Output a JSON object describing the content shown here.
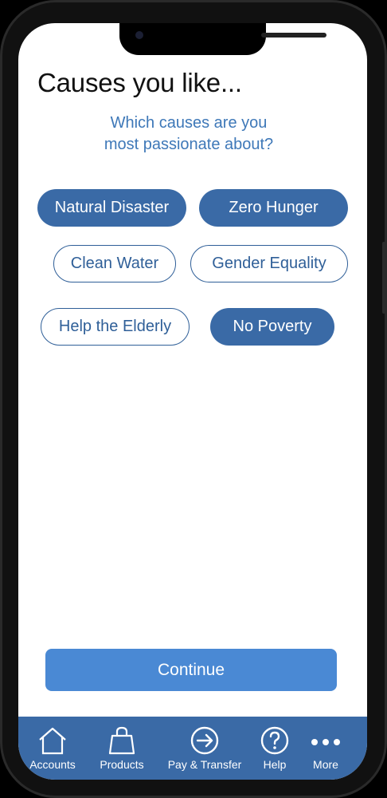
{
  "header": {
    "title": "Causes you like...",
    "subtitle_line1": "Which causes are you",
    "subtitle_line2": "most passionate about?"
  },
  "causes": [
    {
      "label": "Natural Disaster",
      "selected": true
    },
    {
      "label": "Zero Hunger",
      "selected": true
    },
    {
      "label": "Clean Water",
      "selected": false
    },
    {
      "label": "Gender Equality",
      "selected": false
    },
    {
      "label": "Help the Elderly",
      "selected": false
    },
    {
      "label": "No Poverty",
      "selected": true
    }
  ],
  "actions": {
    "continue_label": "Continue"
  },
  "tabbar": {
    "items": [
      {
        "label": "Accounts",
        "icon": "home-icon"
      },
      {
        "label": "Products",
        "icon": "bag-icon"
      },
      {
        "label": "Pay & Transfer",
        "icon": "arrow-circle-icon"
      },
      {
        "label": "Help",
        "icon": "question-circle-icon"
      },
      {
        "label": "More",
        "icon": "more-dots-icon"
      }
    ]
  },
  "colors": {
    "accent": "#3a6aa6",
    "subtitle": "#3e78b8",
    "button": "#4a89d4"
  }
}
